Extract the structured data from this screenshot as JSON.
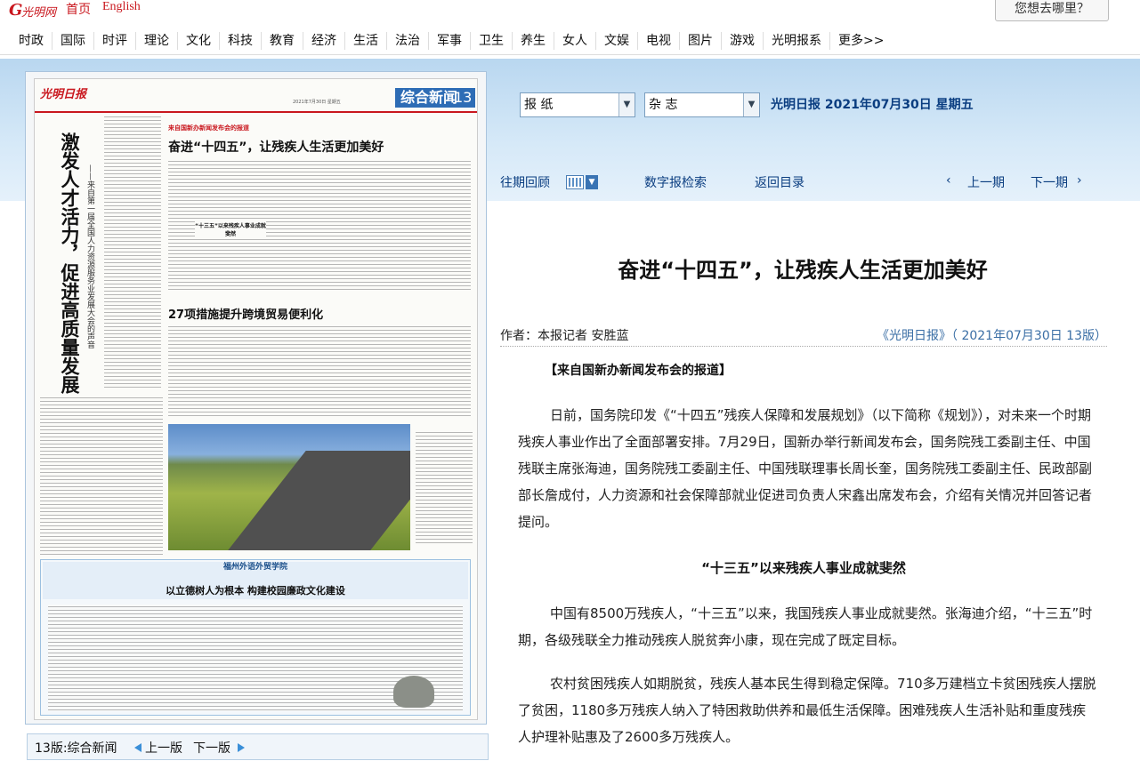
{
  "topbar": {
    "logo": "光明网",
    "links": [
      "首页",
      "English"
    ],
    "search_button": "您想去哪里？"
  },
  "channels": [
    "时政",
    "国际",
    "时评",
    "理论",
    "文化",
    "科技",
    "教育",
    "经济",
    "生活",
    "法治",
    "军事",
    "卫生",
    "养生",
    "女人",
    "文娱",
    "电视",
    "图片",
    "游戏",
    "光明报系",
    "更多>>"
  ],
  "selectors": {
    "newspaper": "报 纸",
    "magazine": "杂 志"
  },
  "dateline": "光明日报 2021年07月30日 星期五",
  "tools": {
    "archive": "往期回顾",
    "digital_search": "数字报检索",
    "back_to_toc": "返回目录",
    "prev_page": "上一期",
    "next_page": "下一期",
    "prev_arrow": "‹",
    "next_arrow": "›"
  },
  "newspaper_image": {
    "masthead": "光明日报",
    "section": "综合新闻",
    "page_number": "13",
    "date": "2021年7月30日 星期五",
    "vertical_title": "激发人才活力，促进高质量发展",
    "vertical_subtitle": "——来自第一届全国人力资源服务业发展大会的声音",
    "kicker": "来自国新办新闻发布会的报道",
    "headline_1": "奋进“十四五”，让残疾人生活更加美好",
    "subhead_1": "“十三五”以来残疾人事业成就斐然",
    "headline_2": "27项措施提升跨境贸易便利化",
    "box_banner": "福州外语外贸学院",
    "box_title": "以立德树人为根本 构建校园廉政文化建设"
  },
  "article": {
    "title": "奋进“十四五”，让残疾人生活更加美好",
    "author": "作者：本报记者 安胜蓝",
    "source": "《光明日报》（ 2021年07月30日 13版）",
    "kicker": "【来自国新办新闻发布会的报道】",
    "paragraphs": [
      "日前，国务院印发《“十四五”残疾人保障和发展规划》（以下简称《规划》），对未来一个时期残疾人事业作出了全面部署安排。7月29日，国新办举行新闻发布会，国务院残工委副主任、中国残联主席张海迪，国务院残工委副主任、中国残联理事长周长奎，国务院残工委副主任、民政部副部长詹成付，人力资源和社会保障部就业促进司负责人宋鑫出席发布会，介绍有关情况并回答记者提问。",
      "中国有8500万残疾人，“十三五”以来，我国残疾人事业成就斐然。张海迪介绍，“十三五”时期，各级残联全力推动残疾人脱贫奔小康，现在完成了既定目标。",
      "农村贫困残疾人如期脱贫，残疾人基本民生得到稳定保障。710多万建档立卡贫困残疾人摆脱了贫困，1180多万残疾人纳入了特困救助供养和最低生活保障。困难残疾人生活补贴和重度残疾人护理补贴惠及了2600多万残疾人。"
    ],
    "subhead": "“十三五”以来残疾人事业成就斐然"
  },
  "pagebar": {
    "label": "13版:综合新闻",
    "prev": "上一版",
    "next": "下一版"
  }
}
